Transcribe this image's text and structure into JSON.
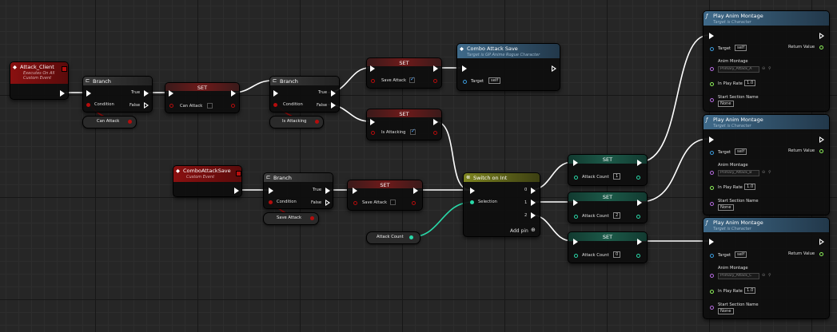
{
  "colors": {
    "exec_wire": "#ffffff",
    "bool_wire": "#b50d0d",
    "int_wire": "#29d8a8",
    "event_header": "#7a0f0f",
    "function_header": "#2f4d66",
    "switch_header": "#5e6319"
  },
  "event_attack": {
    "title": "Attack_Client",
    "sub1": "Executes On All",
    "sub2": "Custom Event"
  },
  "event_combo": {
    "title": "ComboAttackSave",
    "sub": "Custom Event"
  },
  "branch1": {
    "title": "Branch",
    "condition": "Condition",
    "true_label": "True",
    "false_label": "False"
  },
  "branch2": {
    "title": "Branch",
    "condition": "Condition",
    "true_label": "True",
    "false_label": "False"
  },
  "branch3": {
    "title": "Branch",
    "condition": "Condition",
    "true_label": "True",
    "false_label": "False"
  },
  "var_can_attack": "Can Attack",
  "var_is_attacking": "Is Attacking",
  "var_save_attack": "Save Attack",
  "var_attack_count": "Attack Count",
  "set_can_attack": {
    "title": "SET",
    "label": "Can Attack"
  },
  "set_save_attack1": {
    "title": "SET",
    "label": "Save Attack"
  },
  "set_is_attacking": {
    "title": "SET",
    "label": "Is Attacking"
  },
  "set_save_attack2": {
    "title": "SET",
    "label": "Save Attack"
  },
  "combo_save": {
    "title": "Combo Attack Save",
    "sub": "Target is GP Anime Rogue Character",
    "target": "Target",
    "target_value": "self"
  },
  "switch": {
    "title": "Switch on Int",
    "selection": "Selection",
    "out0": "0",
    "out1": "1",
    "out2": "2",
    "add_pin": "Add pin"
  },
  "set_count1": {
    "title": "SET",
    "label": "Attack Count",
    "value": "1"
  },
  "set_count2": {
    "title": "SET",
    "label": "Attack Count",
    "value": "2"
  },
  "set_count0": {
    "title": "SET",
    "label": "Attack Count",
    "value": "0"
  },
  "montage1": {
    "title": "Play Anim Montage",
    "sub": "Target is Character",
    "target": "Target",
    "target_value": "self",
    "return": "Return Value",
    "anim": "Anim Montage",
    "anim_value": "Primary_Attack_A",
    "rate": "In Play Rate",
    "rate_value": "1.0",
    "section": "Start Section Name",
    "section_value": "None"
  },
  "montage2": {
    "title": "Play Anim Montage",
    "sub": "Target is Character",
    "target": "Target",
    "target_value": "self",
    "return": "Return Value",
    "anim": "Anim Montage",
    "anim_value": "Primary_Attack_B",
    "rate": "In Play Rate",
    "rate_value": "1.0",
    "section": "Start Section Name",
    "section_value": "None"
  },
  "montage3": {
    "title": "Play Anim Montage",
    "sub": "Target is Character",
    "target": "Target",
    "target_value": "self",
    "return": "Return Value",
    "anim": "Anim Montage",
    "anim_value": "Primary_Attack_C",
    "rate": "In Play Rate",
    "rate_value": "1.0",
    "section": "Start Section Name",
    "section_value": "None"
  }
}
